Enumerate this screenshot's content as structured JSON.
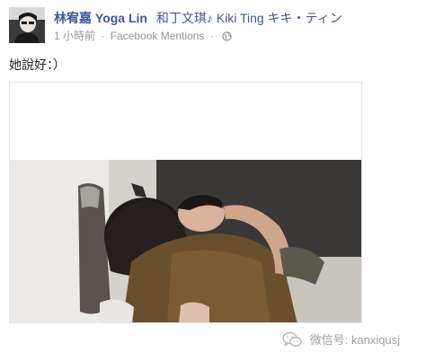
{
  "post": {
    "author_name": "林宥嘉 Yoga Lin",
    "tagged_name": "和丁文琪♪ Kiki Ting キキ・ティン",
    "timestamp": "1 小時前",
    "separator": "·",
    "source_label": "Facebook Mentions",
    "privacy_icon": "globe-icon",
    "status_text": "她說好：）"
  },
  "watermark": {
    "icon": "wechat-icon",
    "text": "微信号: kanxiqusj"
  },
  "colors": {
    "link": "#3b5998",
    "meta": "#90949c",
    "text": "#1d2129"
  }
}
